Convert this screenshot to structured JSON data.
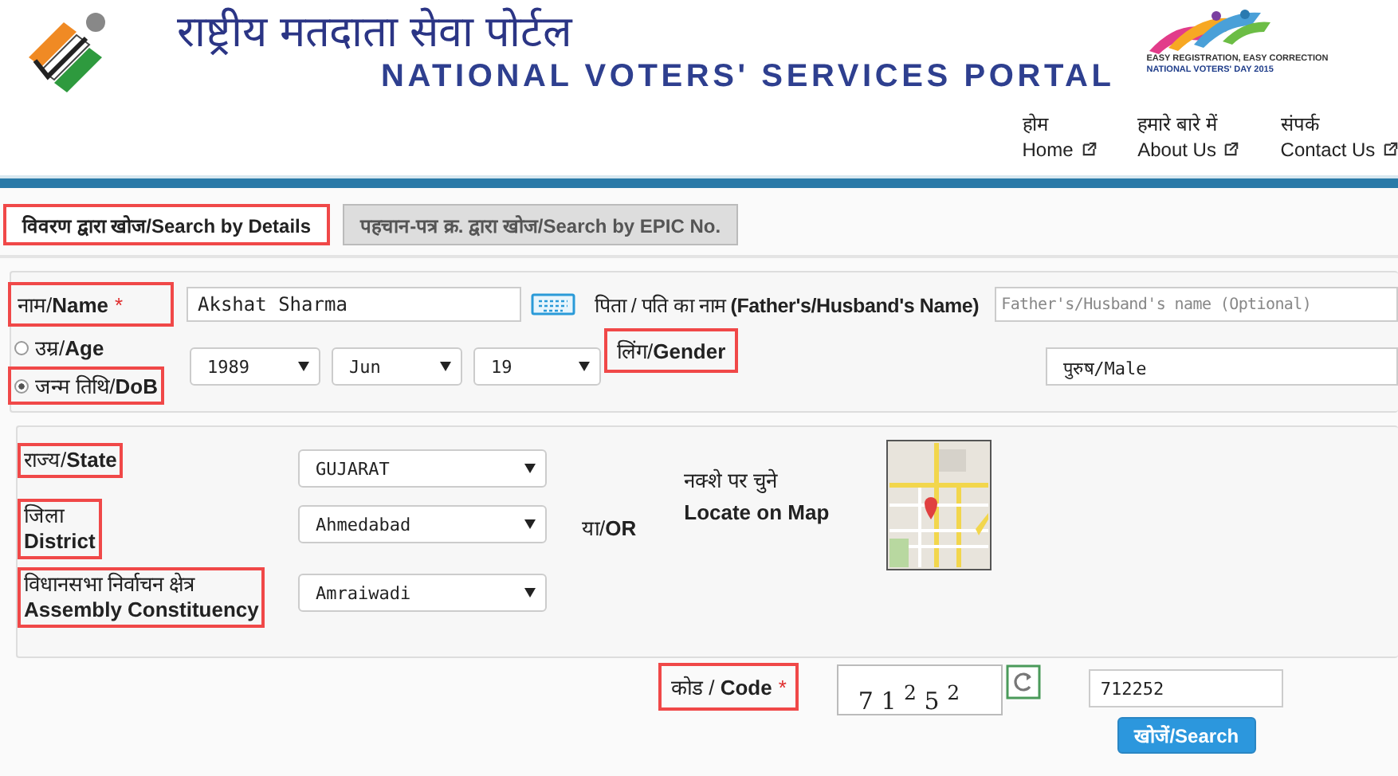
{
  "header": {
    "title_hindi": "राष्ट्रीय मतदाता सेवा पोर्टल",
    "title_english": "NATIONAL VOTERS' SERVICES PORTAL",
    "badge_lines": [
      "EASY REGISTRATION, EASY CORRECTION",
      "NATIONAL VOTERS' DAY 2015"
    ]
  },
  "nav": [
    {
      "hindi": "होम",
      "english": "Home"
    },
    {
      "hindi": "हमारे बारे में",
      "english": "About Us"
    },
    {
      "hindi": "संपर्क",
      "english": "Contact Us"
    }
  ],
  "tabs": [
    {
      "label": "विवरण द्वारा खोज/Search by Details",
      "selected": true,
      "highlighted": true
    },
    {
      "label": "पहचान-पत्र क्र. द्वारा खोज/Search by EPIC No.",
      "selected": false,
      "highlighted": false
    }
  ],
  "name_field": {
    "label": "नाम/**Name**",
    "required_mark": "*",
    "highlighted": true,
    "value": "Akshat Sharma"
  },
  "relative_name": {
    "label": "पिता / पति का नाम **(Father's/Husband's Name)**",
    "placeholder": "Father's/Husband's name (Optional)"
  },
  "age_options": [
    {
      "label": "उम्र/**Age**",
      "selected": false,
      "highlighted": false
    },
    {
      "label": "जन्म तिथि/**DoB**",
      "selected": true,
      "highlighted": true
    }
  ],
  "dob": [
    "1989",
    "Jun",
    "19"
  ],
  "gender": {
    "label": "लिंग/**Gender**",
    "highlighted": true,
    "value": "पुरुष/Male"
  },
  "location": {
    "fields": [
      {
        "label_lines": [
          "राज्य/**State**"
        ],
        "highlighted": true,
        "value": "GUJARAT"
      },
      {
        "label_lines": [
          "जिला",
          "**District**"
        ],
        "highlighted": true,
        "value": "Ahmedabad"
      },
      {
        "label_lines": [
          "विधानसभा निर्वाचन क्षेत्र",
          "**Assembly Constituency**"
        ],
        "highlighted": true,
        "value": "Amraiwadi"
      }
    ],
    "or": "या/**OR**",
    "map_label": [
      "नक्शे पर चुने",
      "Locate on Map"
    ]
  },
  "code": {
    "label": "कोड / **Code**",
    "required_mark": "*",
    "highlighted": true,
    "captcha": "7 1 $^{2}$ 5 $^{2}$",
    "value": "712252",
    "button": "खोजें/Search"
  }
}
